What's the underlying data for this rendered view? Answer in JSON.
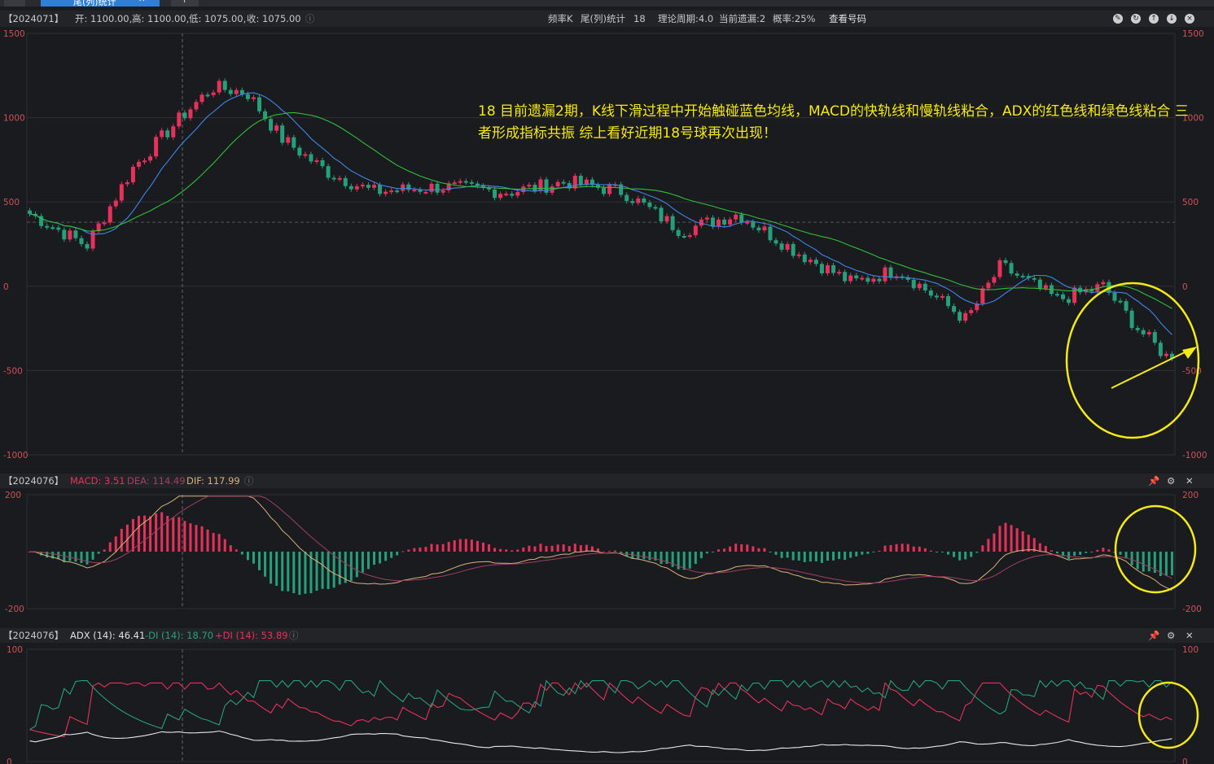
{
  "tabs": {
    "home_icon": "home-icon",
    "active_label": "尾(列)统计",
    "close_glyph": "✕",
    "add_glyph": "+"
  },
  "main": {
    "code": "【2024071】",
    "open_label": "开: 1100.00,",
    "high_label": "高: 1100.00,",
    "low_label": "低: 1075.00,",
    "close_label": "收: 1075.00",
    "freq_label": "频率K",
    "tail_label": "尾(列)统计",
    "tail_value": "18",
    "cycle_label": "理论周期:4.0",
    "miss_label": "当前遗漏:2",
    "prob_label": "概率:25%",
    "view_button": "查看号码",
    "y_ticks": [
      "1500",
      "1000",
      "500",
      "0",
      "-500",
      "-1000"
    ],
    "annotation": "18  目前遗漏2期，K线下滑过程中开始触碰蓝色均线，MACD的快轨线和慢轨线粘合，ADX的红色线和绿色线粘合 三者形成指标共振 综上看好近期18号球再次出现！"
  },
  "macd": {
    "code": "【2024076】",
    "macd_label": "MACD: 3.51",
    "dea_label": "DEA: 114.49",
    "dif_label": "DIF: 117.99",
    "y_ticks": [
      "200",
      "-200"
    ]
  },
  "adx": {
    "code": "【2024076】",
    "adx_label": "ADX (14): 46.41",
    "mdi_label": "-DI (14): 18.70",
    "pdi_label": "+DI (14): 53.89",
    "y_ticks": [
      "100",
      "0"
    ]
  },
  "colors": {
    "up": "#e8315a",
    "down": "#26a07a",
    "ma_fast": "#3f86e8",
    "ma_slow": "#2fbf3a",
    "annotation": "#f5ea14",
    "highlight": "#f5ea14"
  },
  "chart_data": [
    {
      "type": "candlestick",
      "ylim": [
        -1000,
        1500
      ],
      "y_ticks": [
        1500,
        1000,
        500,
        0,
        -500,
        -1000
      ],
      "series": [
        {
          "name": "open",
          "values": [
            1100
          ]
        },
        {
          "name": "high",
          "values": [
            1100
          ]
        },
        {
          "name": "low",
          "values": [
            1075
          ]
        },
        {
          "name": "close",
          "values": [
            1075
          ]
        }
      ]
    },
    {
      "type": "bar",
      "ylim": [
        -200,
        200
      ],
      "series": [
        {
          "name": "MACD",
          "values": [
            3.51
          ]
        },
        {
          "name": "DEA",
          "values": [
            114.49
          ]
        },
        {
          "name": "DIF",
          "values": [
            117.99
          ]
        }
      ]
    },
    {
      "type": "line",
      "ylim": [
        0,
        100
      ],
      "series": [
        {
          "name": "ADX (14)",
          "values": [
            46.41
          ]
        },
        {
          "name": "-DI (14)",
          "values": [
            18.7
          ]
        },
        {
          "name": "+DI (14)",
          "values": [
            53.89
          ]
        }
      ]
    }
  ]
}
